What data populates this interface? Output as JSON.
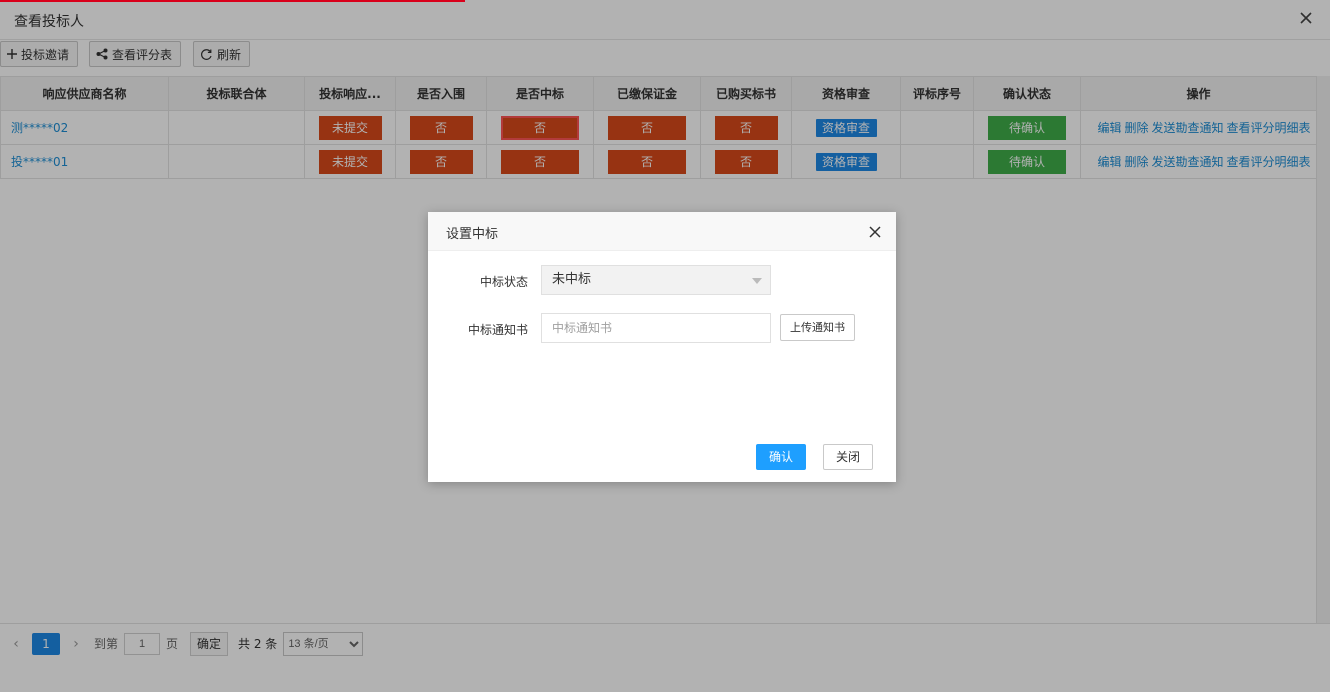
{
  "window": {
    "title": "查看投标人"
  },
  "toolbar": {
    "invite_label": "投标邀请",
    "view_score_label": "查看评分表",
    "refresh_label": "刷新"
  },
  "table": {
    "columns": [
      "响应供应商名称",
      "投标联合体",
      "投标响应...",
      "是否入围",
      "是否中标",
      "已缴保证金",
      "已购买标书",
      "资格审查",
      "评标序号",
      "确认状态",
      "操作"
    ],
    "rows": [
      {
        "name": "测*****02",
        "union": "",
        "response": "未提交",
        "shortlisted": "否",
        "winning": "否",
        "deposit": "否",
        "bought": "否",
        "qualification": "资格审查",
        "seq": "",
        "confirm": "待确认"
      },
      {
        "name": "投*****01",
        "union": "",
        "response": "未提交",
        "shortlisted": "否",
        "winning": "否",
        "deposit": "否",
        "bought": "否",
        "qualification": "资格审查",
        "seq": "",
        "confirm": "待确认"
      }
    ],
    "ops": [
      "编辑",
      "删除",
      "发送勘查通知",
      "查看评分明细表"
    ]
  },
  "pager": {
    "current_page": "1",
    "goto_label": "到第",
    "goto_value": "1",
    "page_unit": "页",
    "confirm_label": "确定",
    "total_label": "共 2 条",
    "page_size_label": "13 条/页"
  },
  "dialog": {
    "title": "设置中标",
    "status_label": "中标状态",
    "status_value": "未中标",
    "notice_label": "中标通知书",
    "notice_placeholder": "中标通知书",
    "upload_label": "上传通知书",
    "ok_label": "确认",
    "cancel_label": "关闭"
  },
  "colors": {
    "accent_red": "#d84a1b",
    "blue": "#1e88e5",
    "green": "#3fae49",
    "primary_button": "#1e9fff"
  }
}
